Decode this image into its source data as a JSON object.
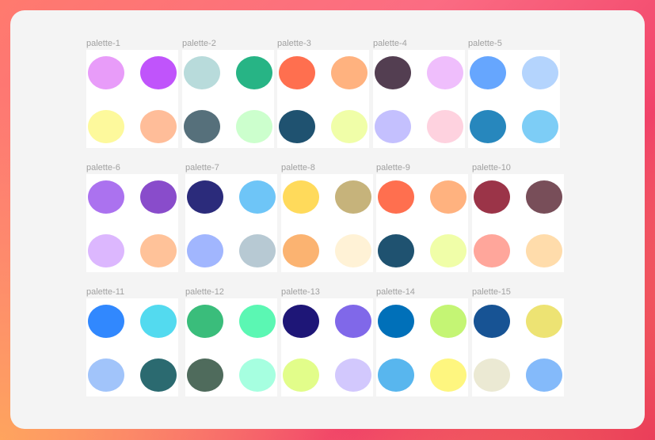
{
  "palettes": [
    {
      "label": "palette-1",
      "colors": [
        "#e89cf9",
        "#c054fb",
        "#fdf99c",
        "#ffbd99"
      ]
    },
    {
      "label": "palette-2",
      "colors": [
        "#b8dbdb",
        "#27b485",
        "#56707b",
        "#ccffcd"
      ]
    },
    {
      "label": "palette-3",
      "colors": [
        "#ff6f4f",
        "#ffb27f",
        "#1f5270",
        "#f0fea8"
      ]
    },
    {
      "label": "palette-4",
      "colors": [
        "#533e51",
        "#efbefc",
        "#c4c0fe",
        "#fed2df"
      ]
    },
    {
      "label": "palette-5",
      "colors": [
        "#66a6fe",
        "#b4d4fd",
        "#2787bd",
        "#7dcdf6"
      ]
    },
    {
      "label": "palette-6",
      "colors": [
        "#ab72ef",
        "#894ccb",
        "#dcb7fe",
        "#ffc299"
      ]
    },
    {
      "label": "palette-7",
      "colors": [
        "#2b2b7b",
        "#6ec5f7",
        "#a1b6fe",
        "#b7c9d3"
      ]
    },
    {
      "label": "palette-8",
      "colors": [
        "#ffda5b",
        "#c6b37b",
        "#fbb371",
        "#fff2d6"
      ]
    },
    {
      "label": "palette-9",
      "colors": [
        "#ff6f4f",
        "#ffb27f",
        "#1f5270",
        "#f0fea8"
      ]
    },
    {
      "label": "palette-10",
      "colors": [
        "#9b3448",
        "#784e59",
        "#ffa69b",
        "#ffdcab"
      ]
    },
    {
      "label": "palette-11",
      "colors": [
        "#3188fe",
        "#53daef",
        "#a1c4fa",
        "#2b6a70"
      ]
    },
    {
      "label": "palette-12",
      "colors": [
        "#3abd7b",
        "#5bf7b3",
        "#4f6b5c",
        "#a6ffe0"
      ]
    },
    {
      "label": "palette-13",
      "colors": [
        "#1e1677",
        "#8068e9",
        "#e2fd8a",
        "#d2c8fd"
      ]
    },
    {
      "label": "palette-14",
      "colors": [
        "#0070b9",
        "#c4f574",
        "#58b6ee",
        "#fef67f"
      ]
    },
    {
      "label": "palette-15",
      "colors": [
        "#175394",
        "#ede373",
        "#ebe9d3",
        "#84bafa"
      ]
    }
  ]
}
